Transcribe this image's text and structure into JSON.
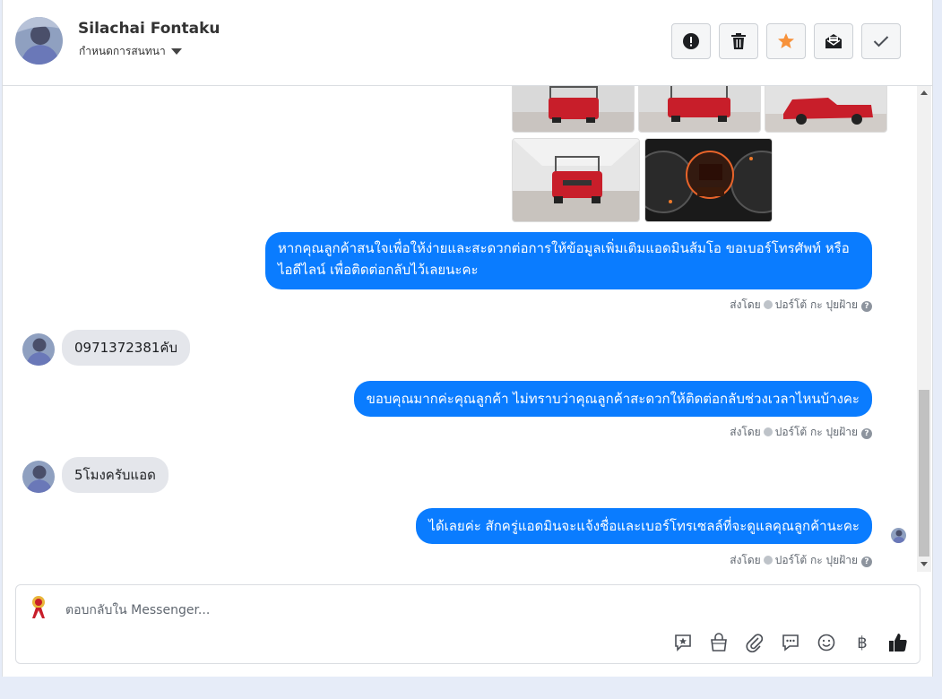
{
  "header": {
    "contact_name": "Silachai Fontaku",
    "assign_label": "กำหนดการสนทนา",
    "actions": [
      "alert-icon",
      "trash-icon",
      "star-icon",
      "mail-icon",
      "check-icon"
    ]
  },
  "messages": [
    {
      "type": "photos"
    },
    {
      "type": "out",
      "text": "หากคุณลูกค้าสนใจเพื่อให้ง่ายและสะดวกต่อการให้ข้อมูลเพิ่มเติมแอดมินส้มโอ ขอเบอร์โทรศัพท์ หรือ ไอดีไลน์ เพื่อติดต่อกลับไว้เลยนะคะ",
      "sent_by": "ส่งโดย",
      "sender": "ปอร์โต้ กะ ปุยฝ้าย"
    },
    {
      "type": "in",
      "text": "0971372381คับ"
    },
    {
      "type": "out",
      "text": "ขอบคุณมากค่ะคุณลูกค้า ไม่ทราบว่าคุณลูกค้าสะดวกให้ติดต่อกลับช่วงเวลาไหนบ้างคะ",
      "sent_by": "ส่งโดย",
      "sender": "ปอร์โต้ กะ ปุยฝ้าย"
    },
    {
      "type": "in",
      "text": "5โมงครับแอด"
    },
    {
      "type": "out",
      "text": "ได้เลยค่ะ สักครู่แอดมินจะแจ้งชื่อและเบอร์โทรเซลล์ที่จะดูแลคุณลูกค้านะคะ",
      "sent_by": "ส่งโดย",
      "sender": "ปอร์โต้ กะ ปุยฝ้าย"
    }
  ],
  "composer": {
    "placeholder": "ตอบกลับใน Messenger...",
    "tools": [
      "quick-reply-icon",
      "bag-icon",
      "attach-icon",
      "saved-reply-icon",
      "emoji-icon",
      "baht-icon",
      "like-icon"
    ],
    "baht_glyph": "฿"
  },
  "colors": {
    "accent": "#0a7cff",
    "bubble_in": "#e4e6eb",
    "star": "#f7923b"
  }
}
